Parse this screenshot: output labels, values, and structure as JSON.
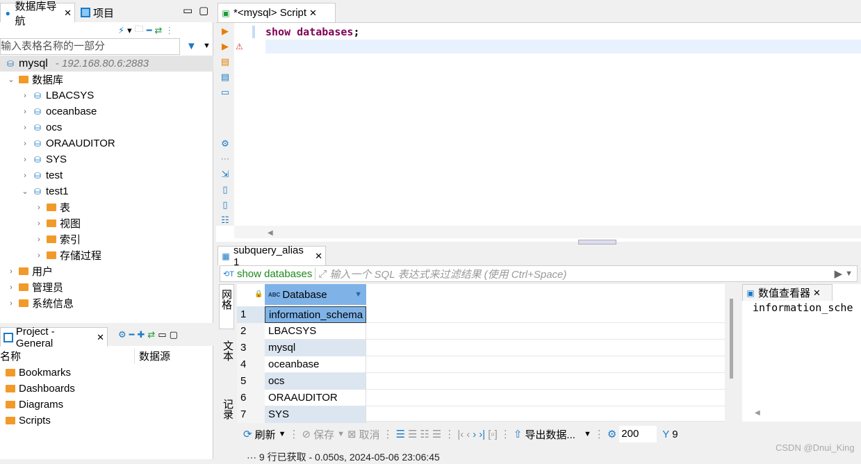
{
  "left_panel": {
    "tabs": [
      {
        "label": "数据库导航",
        "active": true
      },
      {
        "label": "项目",
        "active": false
      }
    ],
    "filter_placeholder": "输入表格名称的一部分",
    "connection": {
      "name": "mysql",
      "host": "- 192.168.80.6:2883"
    },
    "databases_label": "数据库",
    "schemas": [
      "LBACSYS",
      "oceanbase",
      "ocs",
      "ORAAUDITOR",
      "SYS",
      "test",
      "test1"
    ],
    "test1_children": [
      "表",
      "视图",
      "索引",
      "存储过程"
    ],
    "other_nodes": [
      "用户",
      "管理员",
      "系统信息"
    ]
  },
  "project_panel": {
    "title": "Project - General",
    "columns": [
      "名称",
      "数据源"
    ],
    "items": [
      "Bookmarks",
      "Dashboards",
      "Diagrams",
      "Scripts"
    ]
  },
  "editor": {
    "tab_label": "*<mysql> Script",
    "code_keyword": "show databases",
    "code_punct": ";"
  },
  "results": {
    "tab_label": "subquery_alias 1",
    "query_label": "show databases",
    "filter_placeholder": "输入一个 SQL 表达式来过滤结果 (使用 Ctrl+Space)",
    "side_tabs": [
      "网格",
      "文本",
      "记录"
    ],
    "column_header": "Database",
    "rows": [
      {
        "n": "1",
        "v": "information_schema"
      },
      {
        "n": "2",
        "v": "LBACSYS"
      },
      {
        "n": "3",
        "v": "mysql"
      },
      {
        "n": "4",
        "v": "oceanbase"
      },
      {
        "n": "5",
        "v": "ocs"
      },
      {
        "n": "6",
        "v": "ORAAUDITOR"
      },
      {
        "n": "7",
        "v": "SYS"
      }
    ],
    "value_viewer_title": "数值查看器",
    "value_viewer_content": "information_sche",
    "toolbar": {
      "refresh": "刷新",
      "save": "保存",
      "cancel": "取消",
      "export": "导出数据...",
      "fetch_size": "200",
      "count": "9"
    },
    "status": "9 行已获取 - 0.050s, 2024-05-06 23:06:45"
  },
  "watermark": "CSDN @Dnui_King",
  "colors": {
    "accent": "#1b7ac7",
    "header_blue": "#7fb3e8",
    "keyword": "#7f0055",
    "folder": "#f19a2a"
  }
}
